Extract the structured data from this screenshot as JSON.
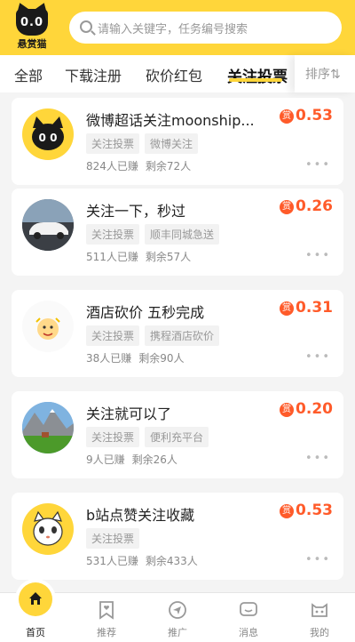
{
  "header": {
    "logo_eyes": "0.0",
    "logo_text": "悬赏猫",
    "search_placeholder": "请输入关键字，任务编号搜索"
  },
  "tabs": [
    {
      "label": "全部"
    },
    {
      "label": "下载注册"
    },
    {
      "label": "砍价红包"
    },
    {
      "label": "关注投票",
      "active": true
    },
    {
      "label": "排序⇅"
    }
  ],
  "tasks": [
    {
      "title": "微博超话关注moonship...",
      "tags": [
        "关注投票",
        "微博关注"
      ],
      "earned": "824人已赚",
      "remaining": "剩余72人",
      "reward": "0.53",
      "badge": "赏",
      "avatar_icon": "cat-logo-avatar-icon"
    },
    {
      "title": "关注一下，秒过",
      "tags": [
        "关注投票",
        "顺丰同城急送"
      ],
      "earned": "511人已赚",
      "remaining": "剩余57人",
      "reward": "0.26",
      "badge": "赏",
      "avatar_icon": "white-car-avatar-icon"
    },
    {
      "title": "酒店砍价 五秒完成",
      "tags": [
        "关注投票",
        "携程酒店砍价"
      ],
      "earned": "38人已赚",
      "remaining": "剩余90人",
      "reward": "0.31",
      "badge": "赏",
      "avatar_icon": "cute-character-avatar-icon"
    },
    {
      "title": "关注就可以了",
      "tags": [
        "关注投票",
        "便利充平台"
      ],
      "earned": "9人已赚",
      "remaining": "剩余26人",
      "reward": "0.20",
      "badge": "赏",
      "avatar_icon": "mountain-landscape-avatar-icon"
    },
    {
      "title": "b站点赞关注收藏",
      "tags": [
        "关注投票"
      ],
      "earned": "531人已赚",
      "remaining": "剩余433人",
      "reward": "0.53",
      "badge": "赏",
      "avatar_icon": "cartoon-cat-avatar-icon"
    }
  ],
  "more_glyph": "•••",
  "nav": [
    {
      "label": "首页",
      "icon": "home-icon",
      "active": true
    },
    {
      "label": "推荐",
      "icon": "bookmark-heart-icon"
    },
    {
      "label": "推广",
      "icon": "send-icon"
    },
    {
      "label": "消息",
      "icon": "message-icon"
    },
    {
      "label": "我的",
      "icon": "cat-face-icon"
    }
  ],
  "colors": {
    "brand": "#ffd63a",
    "reward": "#ff5b2a"
  }
}
